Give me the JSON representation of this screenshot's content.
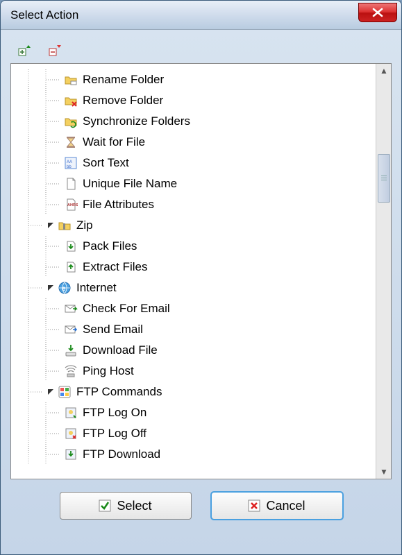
{
  "window": {
    "title": "Select Action"
  },
  "toolbar": {
    "expand_label": "Expand All",
    "collapse_label": "Collapse All"
  },
  "tree": {
    "items": [
      {
        "label": "Rename Folder",
        "icon": "folder-rename",
        "indent": 3,
        "toggle": "",
        "last": false
      },
      {
        "label": "Remove Folder",
        "icon": "folder-delete",
        "indent": 3,
        "toggle": "",
        "last": false
      },
      {
        "label": "Synchronize Folders",
        "icon": "folder-sync",
        "indent": 3,
        "toggle": "",
        "last": false
      },
      {
        "label": "Wait for File",
        "icon": "hourglass",
        "indent": 3,
        "toggle": "",
        "last": false
      },
      {
        "label": "Sort Text",
        "icon": "sort-text",
        "indent": 3,
        "toggle": "",
        "last": false
      },
      {
        "label": "Unique File Name",
        "icon": "file",
        "indent": 3,
        "toggle": "",
        "last": false
      },
      {
        "label": "File Attributes",
        "icon": "attrs",
        "indent": 3,
        "toggle": "",
        "last": true
      },
      {
        "label": "Zip",
        "icon": "zip",
        "indent": 2,
        "toggle": "open",
        "last": false
      },
      {
        "label": "Pack Files",
        "icon": "pack",
        "indent": 3,
        "toggle": "",
        "last": false
      },
      {
        "label": "Extract Files",
        "icon": "extract",
        "indent": 3,
        "toggle": "",
        "last": true
      },
      {
        "label": "Internet",
        "icon": "internet",
        "indent": 2,
        "toggle": "open",
        "last": false
      },
      {
        "label": "Check For Email",
        "icon": "mail-in",
        "indent": 3,
        "toggle": "",
        "last": false
      },
      {
        "label": "Send Email",
        "icon": "mail-out",
        "indent": 3,
        "toggle": "",
        "last": false
      },
      {
        "label": "Download File",
        "icon": "download",
        "indent": 3,
        "toggle": "",
        "last": false
      },
      {
        "label": "Ping Host",
        "icon": "ping",
        "indent": 3,
        "toggle": "",
        "last": true
      },
      {
        "label": "FTP Commands",
        "icon": "ftp",
        "indent": 2,
        "toggle": "open",
        "last": false
      },
      {
        "label": "FTP Log On",
        "icon": "ftp-logon",
        "indent": 3,
        "toggle": "",
        "last": false
      },
      {
        "label": "FTP Log Off",
        "icon": "ftp-logoff",
        "indent": 3,
        "toggle": "",
        "last": false
      },
      {
        "label": "FTP Download",
        "icon": "ftp-download",
        "indent": 3,
        "toggle": "",
        "last": false
      }
    ]
  },
  "buttons": {
    "select": "Select",
    "cancel": "Cancel"
  }
}
